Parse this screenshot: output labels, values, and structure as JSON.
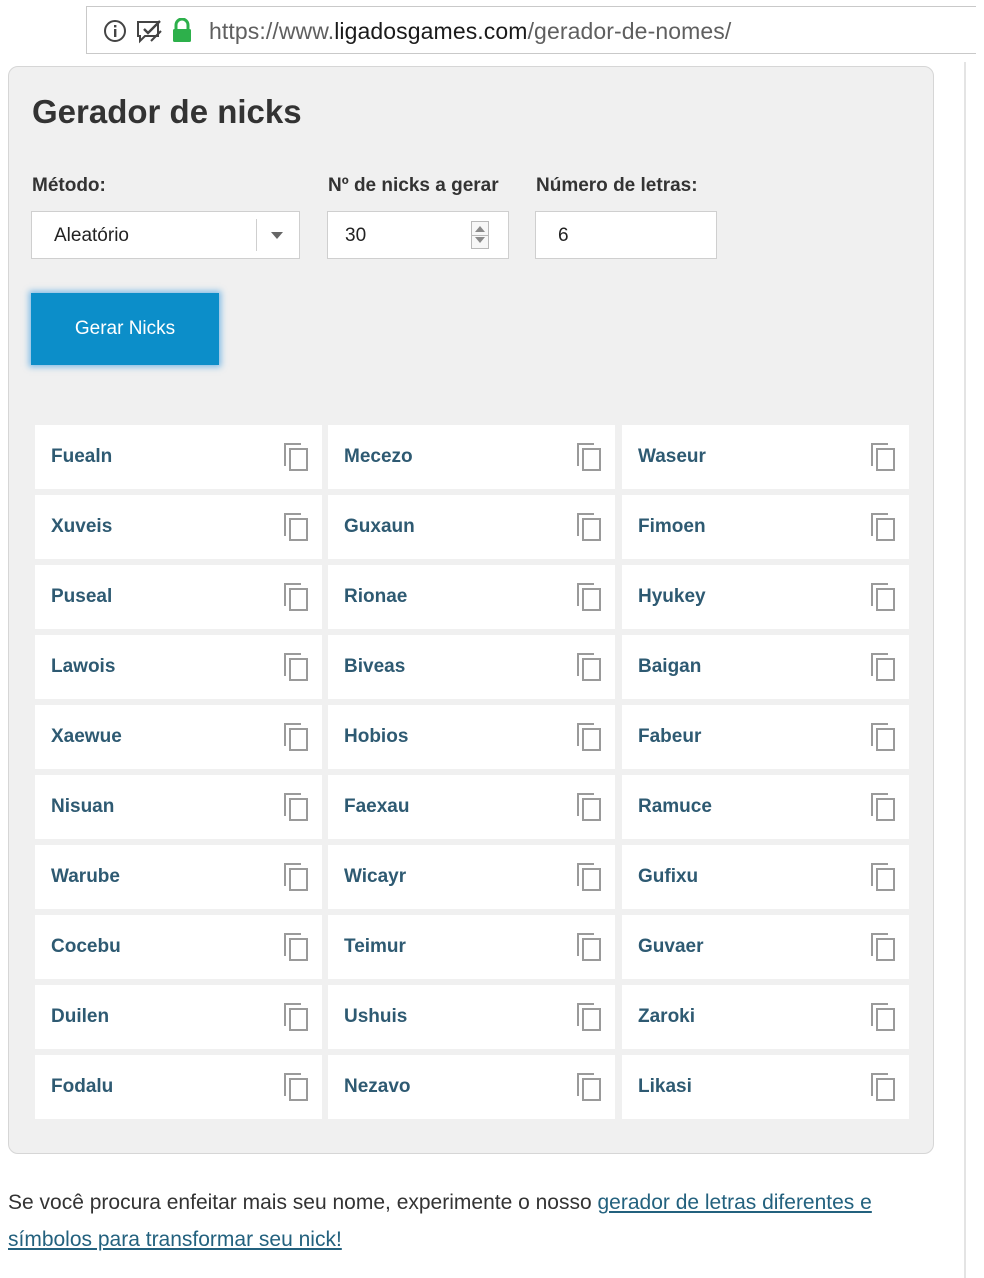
{
  "browser": {
    "url_prefix": "https://www.",
    "url_domain": "ligadosgames.com",
    "url_path": "/gerador-de-nomes/"
  },
  "panel": {
    "title": "Gerador de nicks",
    "method_label": "Método:",
    "method_value": "Aleatório",
    "count_label": "Nº de nicks a gerar",
    "count_value": "30",
    "letters_label": "Número de letras:",
    "letters_value": "6",
    "generate_button": "Gerar Nicks"
  },
  "nicks": [
    [
      "Fuealn",
      "Mecezo",
      "Waseur"
    ],
    [
      "Xuveis",
      "Guxaun",
      "Fimoen"
    ],
    [
      "Puseal",
      "Rionae",
      "Hyukey"
    ],
    [
      "Lawois",
      "Biveas",
      "Baigan"
    ],
    [
      "Xaewue",
      "Hobios",
      "Fabeur"
    ],
    [
      "Nisuan",
      "Faexau",
      "Ramuce"
    ],
    [
      "Warube",
      "Wicayr",
      "Gufixu"
    ],
    [
      "Cocebu",
      "Teimur",
      "Guvaer"
    ],
    [
      "Duilen",
      "Ushuis",
      "Zaroki"
    ],
    [
      "Fodalu",
      "Nezavo",
      "Likasi"
    ]
  ],
  "footer": {
    "text": "Se você procura enfeitar mais seu nome, experimente o nosso ",
    "link_text": "gerador de letras diferentes e símbolos para transformar seu nick!"
  },
  "icons": {
    "info": "info-icon",
    "permissions": "permissions-icon",
    "lock": "lock-icon",
    "copy": "copy-icon"
  },
  "colors": {
    "button": "#0c8ec9",
    "nick_text": "#2e5a72",
    "link": "#23617e",
    "lock": "#2db04b"
  }
}
